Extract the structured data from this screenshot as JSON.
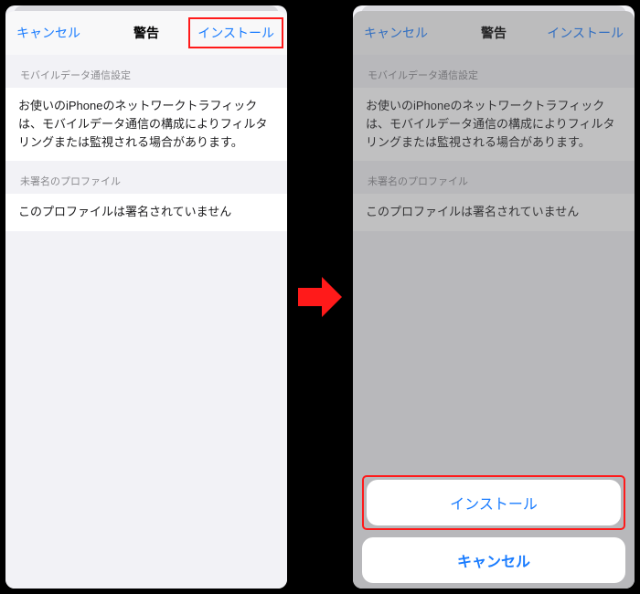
{
  "left": {
    "nav": {
      "cancel": "キャンセル",
      "title": "警告",
      "install": "インストール"
    },
    "sections": {
      "mobile_label": "モバイルデータ通信設定",
      "mobile_body": "お使いのiPhoneのネットワークトラフィックは、モバイルデータ通信の構成によりフィルタリングまたは監視される場合があります。",
      "profile_label": "未署名のプロファイル",
      "profile_body": "このプロファイルは署名されていません"
    }
  },
  "right": {
    "nav": {
      "cancel": "キャンセル",
      "title": "警告",
      "install": "インストール"
    },
    "sections": {
      "mobile_label": "モバイルデータ通信設定",
      "mobile_body": "お使いのiPhoneのネットワークトラフィックは、モバイルデータ通信の構成によりフィルタリングまたは監視される場合があります。",
      "profile_label": "未署名のプロファイル",
      "profile_body": "このプロファイルは署名されていません"
    },
    "action_sheet": {
      "install": "インストール",
      "cancel": "キャンセル"
    }
  }
}
